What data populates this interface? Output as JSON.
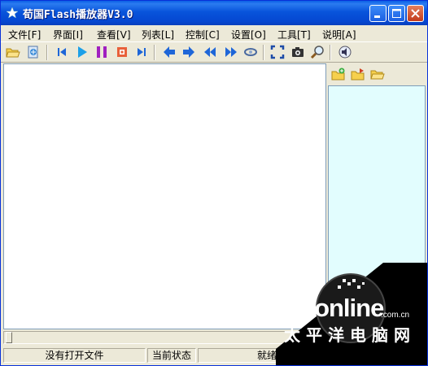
{
  "window": {
    "title": "荀国Flash播放器V3.0",
    "icon": "star-icon",
    "controls": [
      "minimize-icon",
      "maximize-icon",
      "close-icon"
    ]
  },
  "menu": [
    "文件[F]",
    "界面[I]",
    "查看[V]",
    "列表[L]",
    "控制[C]",
    "设置[O]",
    "工具[T]",
    "说明[A]"
  ],
  "toolbar": {
    "icons": [
      "open-folder-icon",
      "open-url-icon",
      "previous-icon",
      "play-icon",
      "pause-icon",
      "stop-icon",
      "next-icon",
      "back-arrow-icon",
      "forward-arrow-icon",
      "rewind-icon",
      "fast-forward-icon",
      "loop-icon",
      "fullscreen-icon",
      "snapshot-camera-icon",
      "zoom-search-icon",
      "volume-speaker-icon"
    ]
  },
  "playlist_toolbar": {
    "icons": [
      "add-file-folder-icon",
      "add-folder-icon",
      "open-list-folder-icon"
    ]
  },
  "seek": {
    "position": 0
  },
  "status": {
    "file": "没有打开文件",
    "state_label": "当前状态",
    "state": "就绪"
  },
  "watermark": {
    "brand": "PConline",
    "domain": ".com.cn",
    "chinese": "太平洋电脑网"
  },
  "colors": {
    "titlebar": "#0854DB",
    "playlist_bg": "#E2FDFE",
    "play_icon": "#1CA0E8",
    "pause_icon": "#A020C0",
    "nav_arrows": "#1E66D8"
  }
}
